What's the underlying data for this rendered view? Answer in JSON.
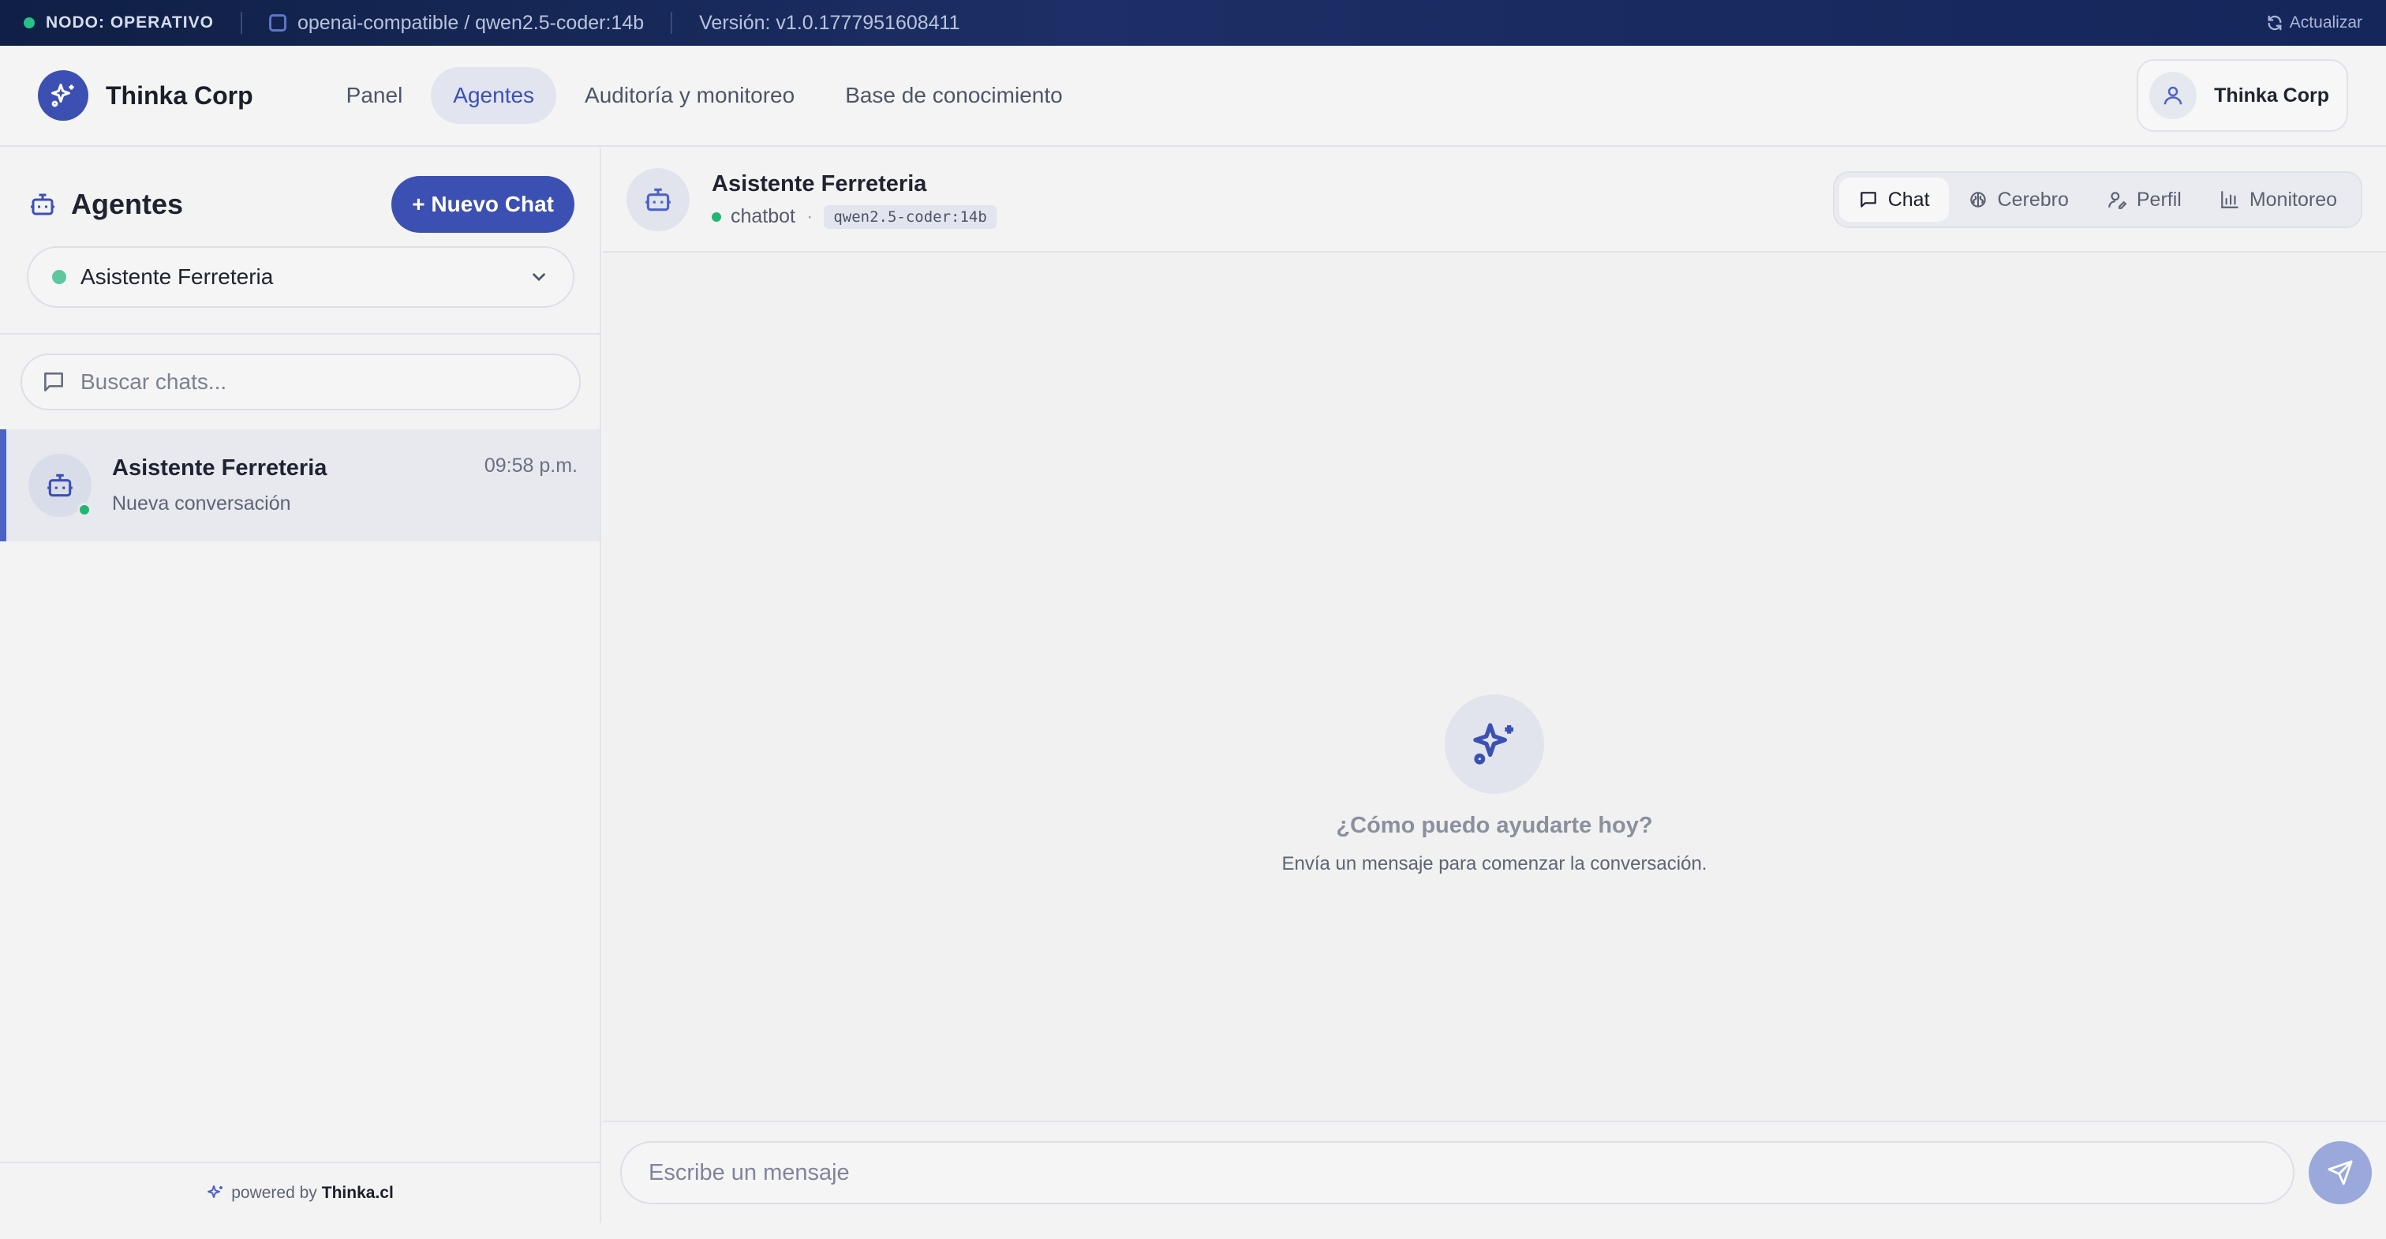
{
  "statusbar": {
    "node_status": "NODO: OPERATIVO",
    "provider": "openai-compatible / qwen2.5-coder:14b",
    "version": "Versión: v1.0.1777951608411",
    "refresh_label": "Actualizar"
  },
  "topnav": {
    "brand": "Thinka Corp",
    "items": [
      {
        "label": "Panel",
        "active": false
      },
      {
        "label": "Agentes",
        "active": true
      },
      {
        "label": "Auditoría y monitoreo",
        "active": false
      },
      {
        "label": "Base de conocimiento",
        "active": false
      }
    ],
    "user_name": "Thinka Corp"
  },
  "sidebar": {
    "title": "Agentes",
    "new_chat_label": "+ Nuevo Chat",
    "selected_agent": "Asistente Ferreteria",
    "search_placeholder": "Buscar chats...",
    "chats": [
      {
        "name": "Asistente Ferreteria",
        "subtitle": "Nueva conversación",
        "time": "09:58 p.m."
      }
    ],
    "powered_prefix": "powered by",
    "powered_brand": "Thinka.cl"
  },
  "chat": {
    "agent_name": "Asistente Ferreteria",
    "agent_type": "chatbot",
    "model": "qwen2.5-coder:14b",
    "tabs": [
      {
        "label": "Chat",
        "active": true
      },
      {
        "label": "Cerebro",
        "active": false
      },
      {
        "label": "Perfil",
        "active": false
      },
      {
        "label": "Monitoreo",
        "active": false
      }
    ],
    "empty_title": "¿Cómo puedo ayudarte hoy?",
    "empty_subtitle": "Envía un mensaje para comenzar la conversación.",
    "composer_placeholder": "Escribe un mensaje"
  },
  "colors": {
    "accent": "#3c50b3",
    "online": "#22b573",
    "statusbar_bg": "#0f1f45"
  },
  "icons": [
    "sparkles-icon",
    "cpu-icon",
    "refresh-icon",
    "user-icon",
    "bot-icon",
    "chevron-down-icon",
    "message-icon",
    "brain-icon",
    "user-pen-icon",
    "bar-chart-icon",
    "send-icon"
  ]
}
